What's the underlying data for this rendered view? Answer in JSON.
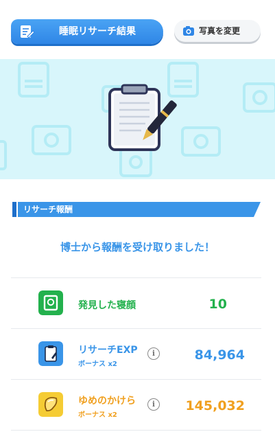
{
  "header": {
    "title": "睡眠リサーチ結果",
    "photo_button": "写真を変更"
  },
  "section": {
    "title": "リサーチ報酬"
  },
  "message": "博士から報酬を受け取りました！",
  "rewards": [
    {
      "name": "発見した寝顔",
      "sub": "",
      "value": "10",
      "color": "#23b14d",
      "icon": "sleep-face-card-icon"
    },
    {
      "name": "リサーチEXP",
      "sub": "ボーナス x2",
      "value": "84,964",
      "color": "#3a95e8",
      "icon": "research-clipboard-icon"
    },
    {
      "name": "ゆめのかけら",
      "sub": "ボーナス x2",
      "value": "145,032",
      "color": "#f0a020",
      "icon": "dream-shard-icon"
    }
  ],
  "colors": {
    "accent_blue": "#3a95e8",
    "banner_bg": "#d8f6fb",
    "green": "#23b14d",
    "orange": "#f0a020"
  }
}
